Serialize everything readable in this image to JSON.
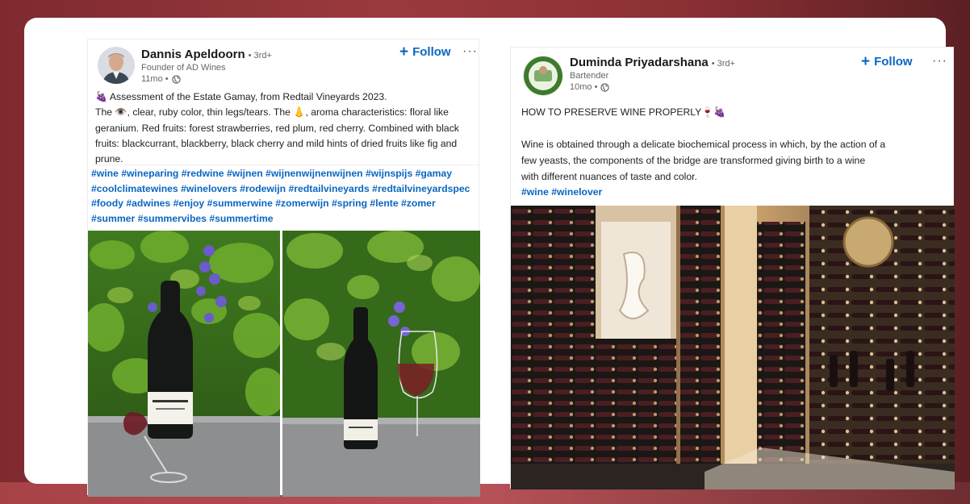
{
  "posts": [
    {
      "author": "Dannis Apeldoorn",
      "degree": "• 3rd+",
      "headline": "Founder of AD Wines",
      "time": "11mo •",
      "follow_label": "Follow",
      "more_label": "···",
      "text": [
        "🍇 Assessment of the Estate Gamay, from Redtail Vineyards 2023.",
        "The 👁️, clear, ruby color, thin legs/tears. The 👃, aroma characteristics: floral like",
        "geranium. Red fruits: forest strawberries, red plum, red cherry. Combined with black",
        "fruits: blackcurrant, blackberry, black cherry and mild hints of dried fruits like fig and",
        "prune."
      ],
      "hashtag_lines": [
        "#wine #wineparing #redwine #wijnen #wijnenwijnenwijnen #wijnspijs #gamay",
        "#coolclimatewines #winelovers #rodewijn #redtailvineyards #redtailvineyardspec",
        "#foody #adwines #enjoy #summerwine #zomerwijn #spring #lente #zomer",
        "#summer #summervibes #summertime"
      ]
    },
    {
      "author": "Duminda Priyadarshana",
      "degree": "• 3rd+",
      "headline": "Bartender",
      "time": "10mo •",
      "follow_label": "Follow",
      "more_label": "···",
      "text": [
        "HOW TO PRESERVE WINE PROPERLY🍷🍇",
        "",
        "Wine is obtained through a delicate biochemical process in which, by the action of a",
        "few yeasts, the components of the bridge are transformed giving birth to a wine",
        "with different nuances of taste and color."
      ],
      "hashtag_lines": [
        "#wine #winelover"
      ]
    }
  ],
  "colors": {
    "link": "#0a66c2",
    "background": "#8c3034"
  }
}
